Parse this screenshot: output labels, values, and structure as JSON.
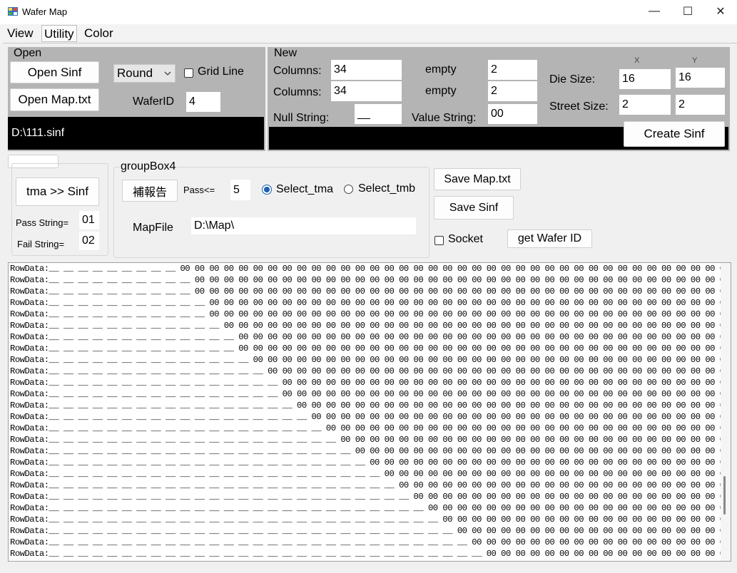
{
  "window": {
    "title": "Wafer Map",
    "minimize": "—",
    "maximize": "☐",
    "close": "✕"
  },
  "menu": [
    "View",
    "Utility",
    "Color"
  ],
  "open_group": {
    "title": "Open",
    "open_sinf": "Open Sinf",
    "open_map": "Open Map.txt",
    "shape_select": "Round",
    "grid_line": "Grid Line",
    "wafer_id_label": "WaferID",
    "wafer_id_value": "4",
    "path": "D:\\111.sinf"
  },
  "new_group": {
    "title": "New",
    "columns_label_1": "Columns:",
    "columns_value_1": "34",
    "columns_label_2": "Columns:",
    "columns_value_2": "34",
    "empty_label_1": "empty",
    "empty_value_1": "2",
    "empty_label_2": "empty",
    "empty_value_2": "2",
    "null_string_label": "Null String:",
    "null_string_value": "__",
    "value_string_label": "Value String:",
    "value_string_value": "00",
    "x_header": "X",
    "y_header": "Y",
    "die_size_label": "Die Size:",
    "die_x": "16",
    "die_y": "16",
    "street_size_label": "Street Size:",
    "street_x": "2",
    "street_y": "2",
    "create_sinf": "Create Sinf"
  },
  "convert_group": {
    "tma_to_sinf": "tma >> Sinf",
    "pass_string_label": "Pass String=",
    "pass_string_value": "01",
    "fail_string_label": "Fail String=",
    "fail_string_value": "02"
  },
  "group_box4": {
    "title": "groupBox4",
    "report_button": "補報告",
    "pass_le_label": "Pass<=",
    "pass_le_value": "5",
    "select_tma": "Select_tma",
    "select_tmb": "Select_tmb",
    "mapfile_label": "MapFile",
    "mapfile_value": "D:\\Map\\"
  },
  "actions": {
    "save_map": "Save Map.txt",
    "save_sinf": "Save Sinf",
    "socket": "Socket",
    "get_wafer_id": "get Wafer ID"
  },
  "row_data": {
    "prefix": "RowData:",
    "null_cell": "__",
    "value_cell": "00",
    "leading_nulls": [
      9,
      10,
      10,
      11,
      11,
      12,
      13,
      13,
      14,
      15,
      16,
      16,
      17,
      18,
      19,
      20,
      21,
      22,
      23,
      24,
      25,
      26,
      27,
      28,
      29,
      30,
      32
    ]
  }
}
